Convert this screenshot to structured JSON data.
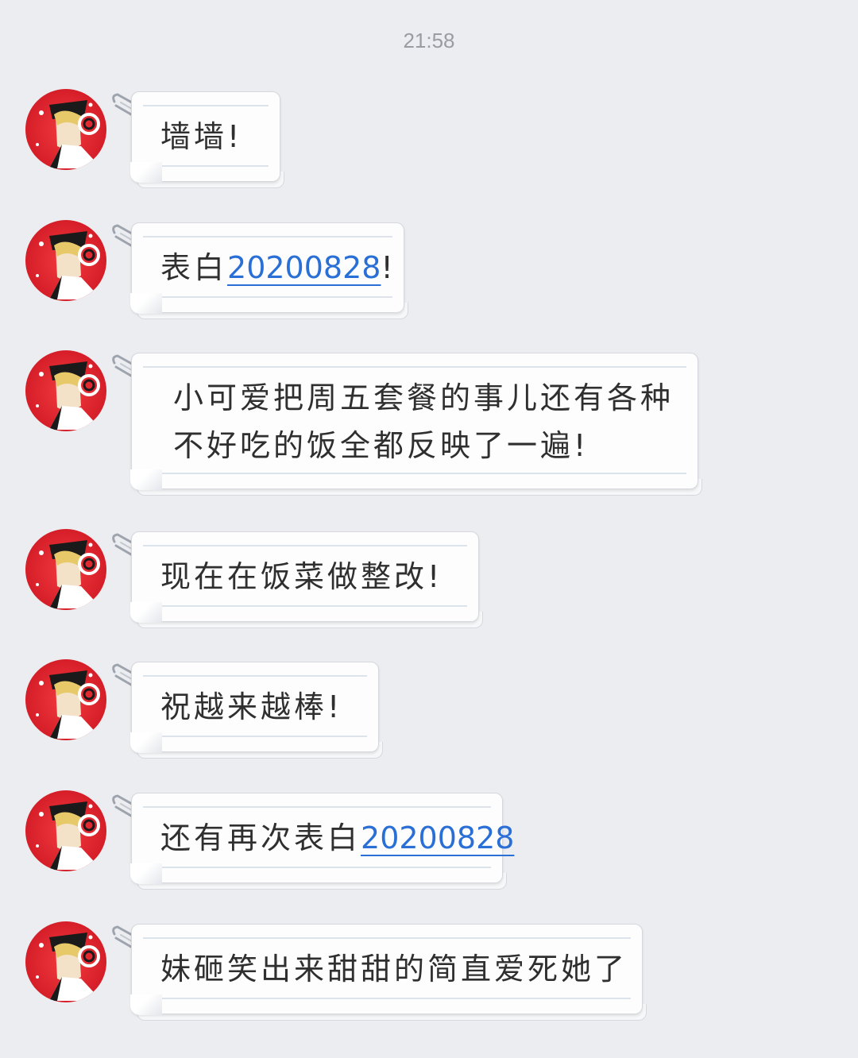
{
  "timestamp": "21:58",
  "messages": [
    {
      "text": "墙墙!",
      "link": ""
    },
    {
      "text": "表白",
      "link": "20200828",
      "suffix": "!"
    },
    {
      "line1": "小可爱把周五套餐的事儿还有各种",
      "line2": "不好吃的饭全都反映了一遍!"
    },
    {
      "text": "现在在饭菜做整改!",
      "link": ""
    },
    {
      "text": "祝越来越棒!",
      "link": ""
    },
    {
      "text": "还有再次表白",
      "link": "20200828"
    },
    {
      "text": "妹砸笑出来甜甜的简直爱死她了",
      "link": ""
    }
  ]
}
